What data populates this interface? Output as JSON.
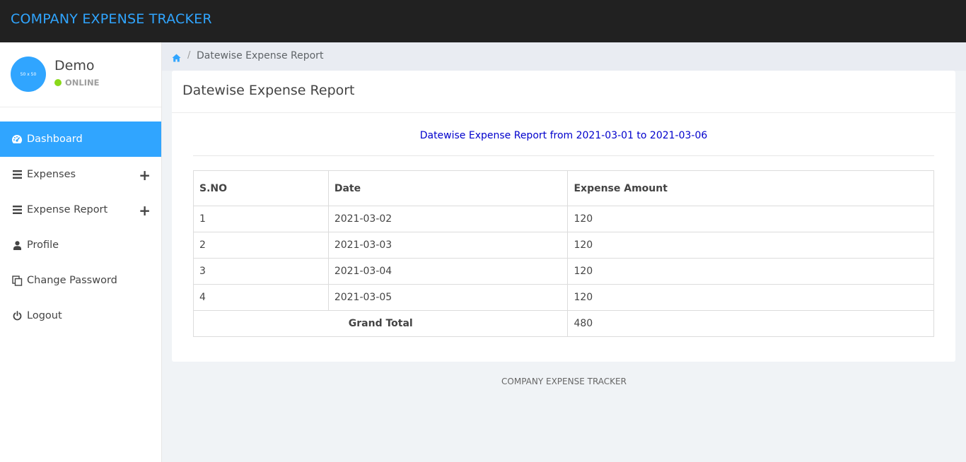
{
  "app": {
    "brand": "COMPANY EXPENSE TRACKER"
  },
  "user": {
    "avatar_text": "50 x 50",
    "name": "Demo",
    "status": "ONLINE"
  },
  "sidebar": {
    "items": [
      {
        "label": "Dashboard",
        "icon": "dashboard-icon",
        "active": true
      },
      {
        "label": "Expenses",
        "icon": "bars-icon",
        "expandable": true
      },
      {
        "label": "Expense Report",
        "icon": "bars-icon",
        "expandable": true
      },
      {
        "label": "Profile",
        "icon": "user-icon"
      },
      {
        "label": "Change Password",
        "icon": "copy-icon"
      },
      {
        "label": "Logout",
        "icon": "power-icon"
      }
    ],
    "expand_symbol": "+"
  },
  "breadcrumb": {
    "separator": "/",
    "current": "Datewise Expense Report"
  },
  "panel": {
    "title": "Datewise Expense Report",
    "subtitle": "Datewise Expense Report from 2021-03-01 to 2021-03-06"
  },
  "table": {
    "headers": [
      "S.NO",
      "Date",
      "Expense Amount"
    ],
    "rows": [
      [
        "1",
        "2021-03-02",
        "120"
      ],
      [
        "2",
        "2021-03-03",
        "120"
      ],
      [
        "3",
        "2021-03-04",
        "120"
      ],
      [
        "4",
        "2021-03-05",
        "120"
      ]
    ],
    "total_label": "Grand Total",
    "total_value": "480"
  },
  "footer": {
    "text": "COMPANY EXPENSE TRACKER"
  },
  "colors": {
    "accent": "#30a5ff",
    "topbar": "#212121",
    "online": "#8ad919",
    "report_subtitle": "#0000cc"
  }
}
